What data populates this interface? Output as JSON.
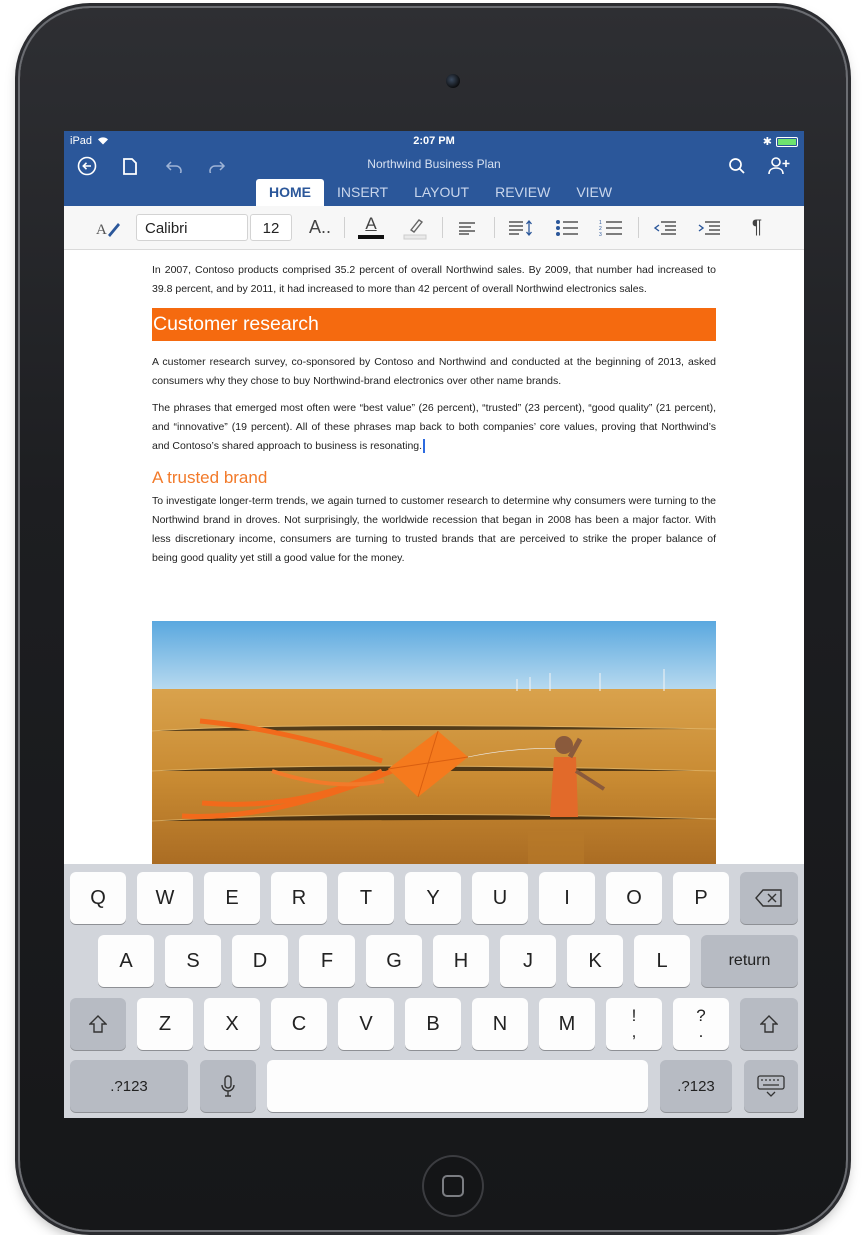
{
  "status_bar": {
    "carrier": "iPad",
    "time": "2:07 PM"
  },
  "app": {
    "document_title": "Northwind Business Plan"
  },
  "ribbon_tabs": [
    "HOME",
    "INSERT",
    "LAYOUT",
    "REVIEW",
    "VIEW"
  ],
  "active_tab": "HOME",
  "ribbon": {
    "font_name": "Calibri",
    "font_size": "12",
    "more_font_label": "A..",
    "font_color_label": "A",
    "font_color": "#111111",
    "paragraph_mark": "¶"
  },
  "document": {
    "para_1": "In 2007, Contoso products comprised 35.2 percent of overall Northwind sales. By 2009, that number had increased to 39.8 percent, and by 2011, it had increased to more than 42 percent of overall Northwind electronics sales.",
    "heading_1": "Customer research",
    "para_2": "A customer research survey, co-sponsored by Contoso and Northwind and conducted at the beginning of 2013, asked consumers why they chose to buy Northwind-brand electronics over other name brands.",
    "para_3": "The phrases that emerged most often were “best value” (26 percent), “trusted” (23 percent), “good quality” (21 percent), and “innovative” (19 percent). All of these phrases map back to both companies’ core values, proving that Northwind’s and Contoso’s shared approach to business is resonating.",
    "heading_2": "A trusted brand",
    "para_4": "To investigate longer-term trends, we again turned to customer research to determine why consumers were turning to the Northwind brand in droves. Not surprisingly, the worldwide recession that began in 2008 has been a major factor. With less discretionary income, consumers are turning to trusted brands that are perceived to strike the proper balance of being good quality yet still a good value for the money."
  },
  "colors": {
    "app_blue": "#2b579a",
    "heading_orange": "#f56a0f",
    "keyboard_bg": "#d2d5db"
  },
  "keyboard": {
    "row1": [
      "Q",
      "W",
      "E",
      "R",
      "T",
      "Y",
      "U",
      "I",
      "O",
      "P"
    ],
    "row2": [
      "A",
      "S",
      "D",
      "F",
      "G",
      "H",
      "J",
      "K",
      "L"
    ],
    "row3": [
      "Z",
      "X",
      "C",
      "V",
      "B",
      "N",
      "M",
      "!\n,",
      "?\n."
    ],
    "return_label": "return",
    "numbers_label": ".?123"
  }
}
